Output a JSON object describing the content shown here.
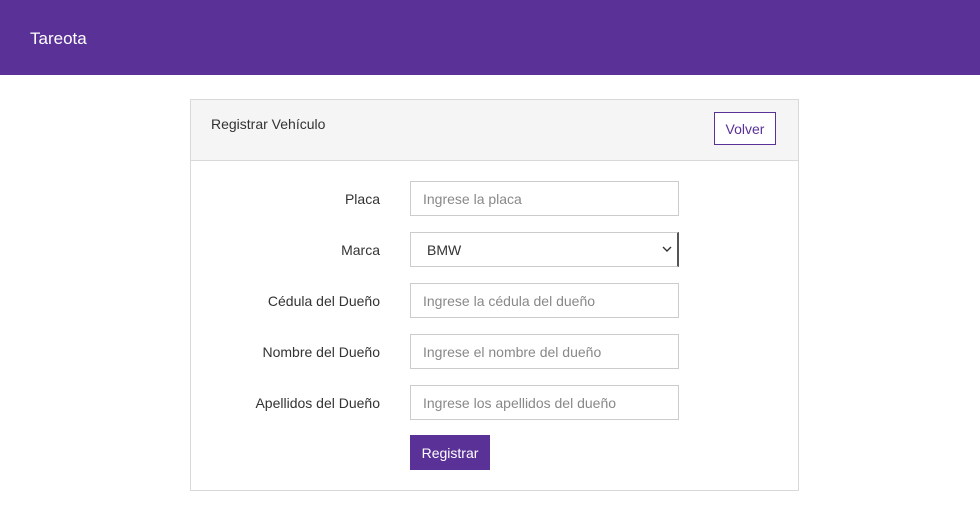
{
  "navbar": {
    "brand": "Tareota",
    "color": "#5a3196"
  },
  "card": {
    "title": "Registrar Vehículo",
    "back_label": "Volver"
  },
  "form": {
    "placa": {
      "label": "Placa",
      "placeholder": "Ingrese la placa",
      "value": ""
    },
    "marca": {
      "label": "Marca",
      "selected": "BMW"
    },
    "cedula": {
      "label": "Cédula del Dueño",
      "placeholder": "Ingrese la cédula del dueño",
      "value": ""
    },
    "nombre": {
      "label": "Nombre del Dueño",
      "placeholder": "Ingrese el nombre del dueño",
      "value": ""
    },
    "apellidos": {
      "label": "Apellidos del Dueño",
      "placeholder": "Ingrese los apellidos del dueño",
      "value": ""
    },
    "submit_label": "Registrar"
  }
}
